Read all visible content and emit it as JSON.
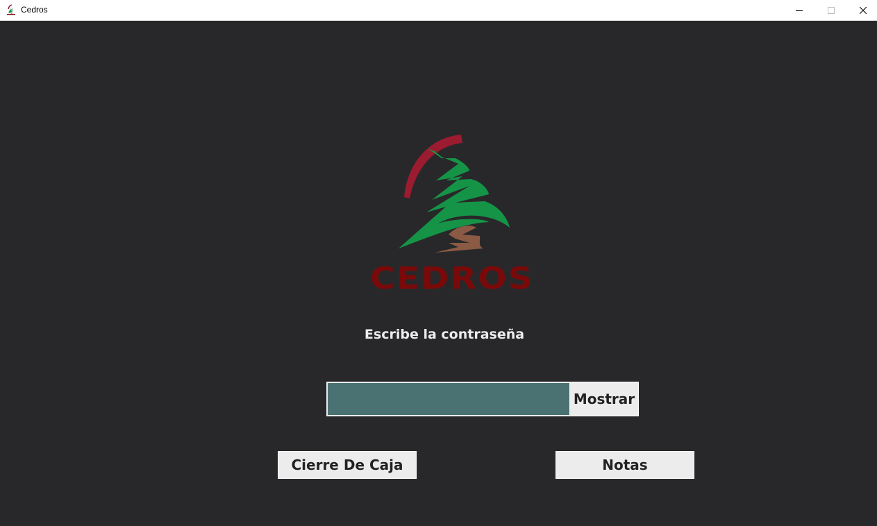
{
  "window": {
    "title": "Cedros",
    "icon": "cedros-tree-icon",
    "controls": [
      "minimize-icon",
      "maximize-icon",
      "close-icon"
    ]
  },
  "logo": {
    "wordmark": "CEDROS",
    "colors": {
      "arc": "#9b1b30",
      "leaves": "#159447",
      "trunk": "#8a5a44",
      "wordmark": "#7a0a0a"
    }
  },
  "login": {
    "prompt": "Escribe la contraseña",
    "password_value": "",
    "show_button": "Mostrar"
  },
  "actions": {
    "cierre_label": "Cierre De Caja",
    "notas_label": "Notas"
  },
  "colors": {
    "background": "#28282a",
    "input_bg": "#4a7273",
    "button_bg": "#ececec",
    "text_light": "#ececec"
  }
}
